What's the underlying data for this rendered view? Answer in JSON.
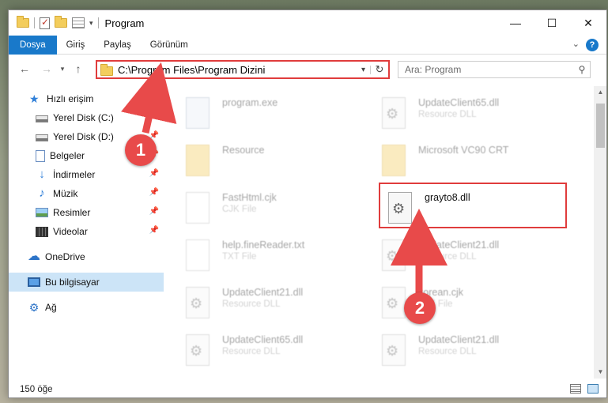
{
  "window": {
    "title": "Program",
    "controls": {
      "minimize": "—",
      "maximize": "☐",
      "close": "✕"
    }
  },
  "ribbon": {
    "tabs": [
      "Dosya",
      "Giriş",
      "Paylaş",
      "Görünüm"
    ],
    "active_tab": "Dosya",
    "help": "?"
  },
  "navbar": {
    "address": "C:\\Program Files\\Program Dizini",
    "search_placeholder": "Ara: Program"
  },
  "sidebar": {
    "items": [
      {
        "label": "Hızlı erişim",
        "icon": "star-icon"
      },
      {
        "label": "Yerel Disk (C:)",
        "icon": "drive-icon",
        "pinned": true
      },
      {
        "label": "Yerel Disk (D:)",
        "icon": "drive-icon",
        "pinned": true
      },
      {
        "label": "Belgeler",
        "icon": "documents-icon",
        "pinned": true
      },
      {
        "label": "İndirmeler",
        "icon": "download-icon",
        "pinned": true
      },
      {
        "label": "Müzik",
        "icon": "music-icon",
        "pinned": true
      },
      {
        "label": "Resimler",
        "icon": "pictures-icon",
        "pinned": true
      },
      {
        "label": "Videolar",
        "icon": "videos-icon",
        "pinned": true
      },
      {
        "label": "OneDrive",
        "icon": "cloud-icon"
      },
      {
        "label": "Bu bilgisayar",
        "icon": "computer-icon",
        "selected": true
      },
      {
        "label": "Ağ",
        "icon": "network-icon"
      }
    ]
  },
  "files": [
    {
      "name": "program.exe",
      "type": "",
      "icon": "exe-icon",
      "faded": true
    },
    {
      "name": "UpdateClient65.dll",
      "type": "Resource DLL",
      "icon": "dll-icon",
      "faded": true
    },
    {
      "name": "Resource",
      "type": "",
      "icon": "folder-icon",
      "faded": true
    },
    {
      "name": "Microsoft VC90 CRT",
      "type": "",
      "icon": "folder-icon",
      "faded": true
    },
    {
      "name": "FastHtml.cjk",
      "type": "CJK File",
      "icon": "file-icon",
      "faded": true
    },
    {
      "name": "grayto8.dll",
      "type": "",
      "icon": "dll-icon",
      "faded": false
    },
    {
      "name": "help.fineReader.txt",
      "type": "TXT File",
      "icon": "file-icon",
      "faded": true
    },
    {
      "name": "UpdateClient21.dll",
      "type": "Resource DLL",
      "icon": "dll-icon",
      "faded": true
    },
    {
      "name": "UpdateClient21.dll",
      "type": "Resource DLL",
      "icon": "dll-icon",
      "faded": true
    },
    {
      "name": "korean.cjk",
      "type": "CJK File",
      "icon": "file-icon",
      "faded": true
    },
    {
      "name": "UpdateClient65.dll",
      "type": "Resource DLL",
      "icon": "dll-icon",
      "faded": true
    },
    {
      "name": "UpdateClient21.dll",
      "type": "Resource DLL",
      "icon": "dll-icon",
      "faded": true
    }
  ],
  "status": {
    "count": "150 öğe"
  },
  "annotations": {
    "step1": "1",
    "step2": "2",
    "accent": "#e03c3c"
  }
}
